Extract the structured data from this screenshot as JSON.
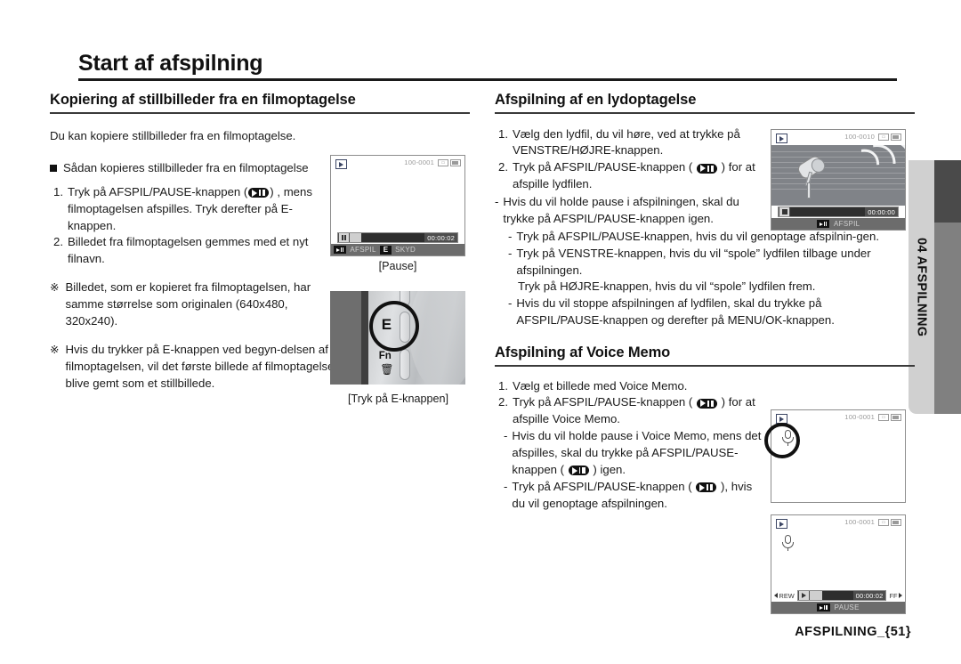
{
  "page": {
    "title": "Start af afspilning",
    "footer": "AFSPILNING_{51}",
    "side_tab": "04 AFSPILNING"
  },
  "left_column": {
    "section_title": "Kopiering af stillbilleder fra en filmoptagelse",
    "intro": "Du kan kopiere stillbilleder fra en filmoptagelse.",
    "bullet_heading": "Sådan kopieres stillbilleder fra en filmoptagelse",
    "steps": [
      {
        "num": "1.",
        "part_a": "Tryk på AFSPIL/PAUSE-knappen (",
        "part_b": ") ,",
        "rest": "mens filmoptagelsen afspilles. Tryk derefter på E-knappen."
      },
      {
        "num": "2.",
        "part_a": "Billedet fra filmoptagelsen gemmes med et nyt filnavn.",
        "part_b": "",
        "rest": ""
      }
    ],
    "notes": [
      {
        "mark": "※",
        "text": "Billedet, som er kopieret fra filmoptagelsen, har samme størrelse som originalen (640x480, 320x240)."
      },
      {
        "mark": "※",
        "text": "Hvis du trykker på E-knappen ved begyn-delsen af filmoptagelsen, vil det første billede af filmoptagelsen blive gemt som et stillbillede."
      }
    ],
    "lcd_pause": {
      "file_number": "100-0001",
      "time_code": "00:00:02",
      "key_label": "AFSPIL",
      "e_label": "E",
      "skyd_label": "SKYD",
      "caption": "[Pause]"
    },
    "camera_photo": {
      "e_button": "E",
      "fn_label": "Fn",
      "caption": "[Tryk på E-knappen]"
    }
  },
  "right_column": {
    "audio_section": {
      "title": "Afspilning af en lydoptagelse",
      "steps": [
        {
          "num": "1.",
          "text": "Vælg den lydfil, du vil høre, ved at trykke på VENSTRE/HØJRE-knappen."
        },
        {
          "num": "2.",
          "part_a": "Tryk på AFSPIL/PAUSE-knappen (",
          "part_b": ")",
          "rest": "for at afspille lydfilen."
        }
      ],
      "sub_items": [
        "Hvis du vil holde pause i afspilningen, skal du trykke på AFSPIL/PAUSE-knappen igen.",
        "Tryk på AFSPIL/PAUSE-knappen, hvis du vil genoptage afspilnin-gen.",
        "Tryk på VENSTRE-knappen, hvis du vil “spole” lydfilen tilbage under afspilningen.",
        "Hvis du vil stoppe afspilningen af lydfilen, skal du trykke på AFSPIL/PAUSE-knappen og derefter på MENU/OK-knappen."
      ],
      "extra_line": "Tryk på HØJRE-knappen, hvis du vil “spole” lydfilen frem.",
      "lcd": {
        "file_number": "100-0010",
        "time_code": "00:00:00",
        "key_label": "AFSPIL"
      }
    },
    "voice_memo_section": {
      "title": "Afspilning af Voice Memo",
      "steps": [
        {
          "num": "1.",
          "text": "Vælg et billede med Voice Memo."
        },
        {
          "num": "2.",
          "part_a": "Tryk på AFSPIL/PAUSE-knappen (",
          "part_b": ")",
          "rest": "for at afspille Voice Memo."
        }
      ],
      "sub_items": [
        {
          "pre": "Hvis du vil holde pause i Voice Memo, mens det afspilles, skal du trykke på AFSPIL/PAUSE-knappen (",
          "post": ") igen."
        },
        {
          "pre": "Tryk på AFSPIL/PAUSE-knappen (",
          "post": "), hvis du vil genoptage afspilningen."
        }
      ],
      "lcd_top": {
        "file_number": "100-0001"
      },
      "lcd_bottom": {
        "file_number": "100-0001",
        "rew_label": "REW",
        "ff_label": "FF",
        "time_code": "00:00:02",
        "state_label": "PAUSE"
      }
    }
  },
  "colors": {
    "tab_light": "#d0d0d0",
    "tab_dark": "#808080",
    "tab_darker": "#4a4a4a",
    "lcd_bar": "#6c6c6c",
    "lcd_track": "#2e2e2e"
  }
}
